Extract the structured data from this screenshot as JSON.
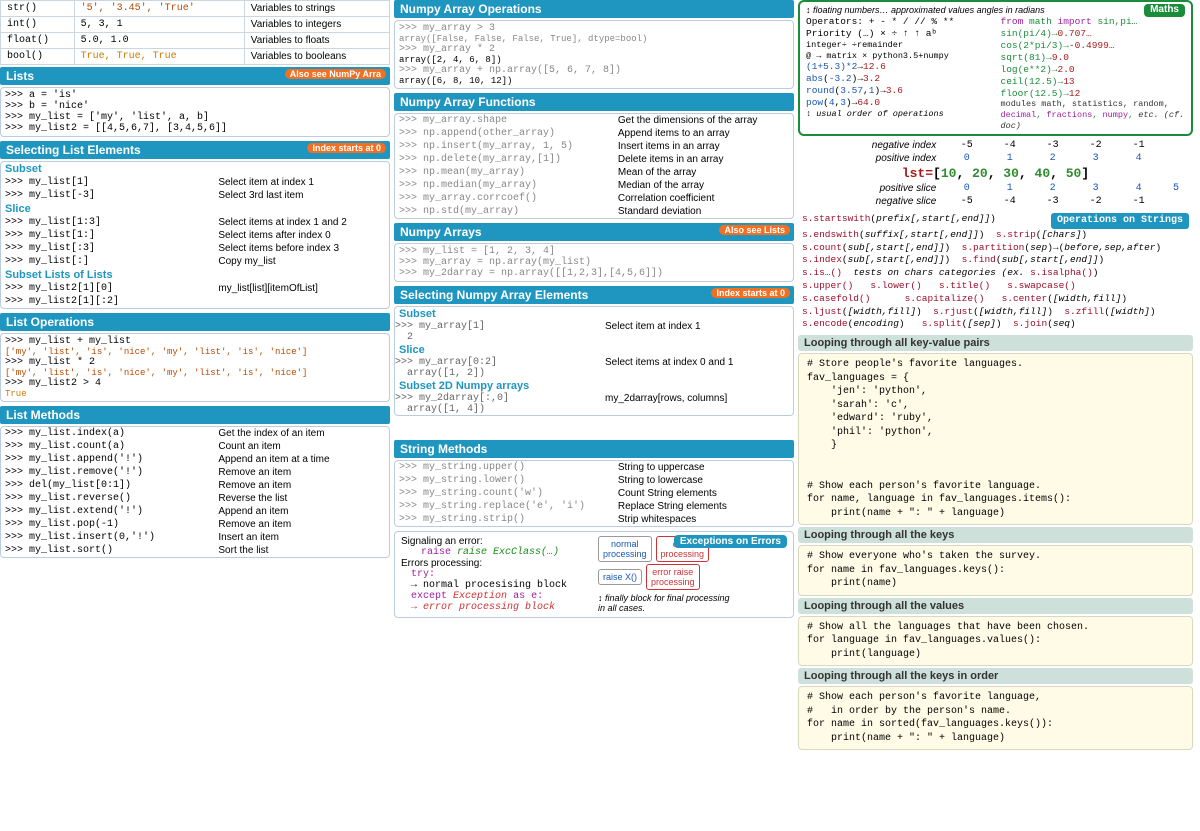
{
  "conv": {
    "rows": [
      {
        "fn": "str()",
        "ex": "'5', '3.45', 'True'",
        "desc": "Variables to strings"
      },
      {
        "fn": "int()",
        "ex": "5, 3, 1",
        "desc": "Variables to integers"
      },
      {
        "fn": "float()",
        "ex": "5.0, 1.0",
        "desc": "Variables to floats"
      },
      {
        "fn": "bool()",
        "ex": "True, True, True",
        "desc": "Variables to booleans"
      }
    ]
  },
  "lists": {
    "header": "Lists",
    "tag": "Also see NumPy Arra",
    "code": ">>> a = 'is'\n>>> b = 'nice'\n>>> my_list = ['my', 'list', a, b]\n>>> my_list2 = [[4,5,6,7], [3,4,5,6]]"
  },
  "selList": {
    "header": "Selecting List Elements",
    "tag": "Index starts at 0",
    "subset": "Subset",
    "subsetRows": [
      {
        "l": ">>> my_list[1]",
        "r": "Select item at index 1"
      },
      {
        "l": ">>> my_list[-3]",
        "r": "Select 3rd last item"
      }
    ],
    "slice": "Slice",
    "sliceRows": [
      {
        "l": ">>> my_list[1:3]",
        "r": "Select items at index 1 and 2"
      },
      {
        "l": ">>> my_list[1:]",
        "r": "Select items after index 0"
      },
      {
        "l": ">>> my_list[:3]",
        "r": "Select items before index 3"
      },
      {
        "l": ">>> my_list[:]",
        "r": "Copy my_list"
      }
    ],
    "subl": "Subset Lists of Lists",
    "sublRows": [
      {
        "l": ">>> my_list2[1][0]",
        "r": "my_list[list][itemOfList]"
      },
      {
        "l": ">>> my_list2[1][:2]",
        "r": ""
      }
    ]
  },
  "listOps": {
    "header": "List Operations",
    "lines": [
      ">>> my_list + my_list",
      "['my', 'list', 'is', 'nice', 'my', 'list', 'is', 'nice']",
      ">>> my_list * 2",
      "['my', 'list', 'is', 'nice', 'my', 'list', 'is', 'nice']",
      ">>> my_list2 > 4",
      "True"
    ]
  },
  "listMeth": {
    "header": "List Methods",
    "rows": [
      {
        "l": ">>> my_list.index(a)",
        "r": "Get the index of an item"
      },
      {
        "l": ">>> my_list.count(a)",
        "r": "Count an item"
      },
      {
        "l": ">>> my_list.append('!')",
        "r": "Append an item at a time"
      },
      {
        "l": ">>> my_list.remove('!')",
        "r": "Remove an item"
      },
      {
        "l": ">>> del(my_list[0:1])",
        "r": "Remove an item"
      },
      {
        "l": ">>> my_list.reverse()",
        "r": "Reverse the list"
      },
      {
        "l": ">>> my_list.extend('!')",
        "r": "Append an item"
      },
      {
        "l": ">>> my_list.pop(-1)",
        "r": "Remove an item"
      },
      {
        "l": ">>> my_list.insert(0,'!')",
        "r": "Insert an item"
      },
      {
        "l": ">>> my_list.sort()",
        "r": "Sort the list"
      }
    ]
  },
  "npOps": {
    "header": "Numpy Array Operations",
    "lines": [
      ">>> my_array > 3",
      "  array([False, False, False,  True], dtype=bool)",
      ">>> my_array * 2",
      "  array([2, 4, 6, 8])",
      ">>> my_array + np.array([5, 6, 7, 8])",
      "  array([6, 8, 10, 12])"
    ]
  },
  "npFns": {
    "header": "Numpy Array Functions",
    "rows": [
      {
        "l": ">>> my_array.shape",
        "r": "Get the dimensions of the array"
      },
      {
        "l": ">>> np.append(other_array)",
        "r": "Append items to an array"
      },
      {
        "l": ">>> np.insert(my_array, 1, 5)",
        "r": "Insert items in an array"
      },
      {
        "l": ">>> np.delete(my_array,[1])",
        "r": "Delete items in an array"
      },
      {
        "l": ">>> np.mean(my_array)",
        "r": "Mean of the array"
      },
      {
        "l": ">>> np.median(my_array)",
        "r": "Median of the array"
      },
      {
        "l": ">>> my_array.corrcoef()",
        "r": "Correlation coefficient"
      },
      {
        "l": ">>> np.std(my_array)",
        "r": "Standard deviation"
      }
    ]
  },
  "npArr": {
    "header": "Numpy Arrays",
    "tag": "Also see Lists",
    "lines": [
      ">>> my_list = [1, 2, 3, 4]",
      ">>> my_array = np.array(my_list)",
      ">>> my_2darray = np.array([[1,2,3],[4,5,6]])"
    ]
  },
  "selNp": {
    "header": "Selecting Numpy Array Elements",
    "tag": "Index starts at 0",
    "subset": "Subset",
    "subsetRow": {
      "l": ">>> my_array[1]\n  2",
      "r": "Select item at index 1"
    },
    "slice": "Slice",
    "sliceRow": {
      "l": ">>> my_array[0:2]\n  array([1, 2])",
      "r": "Select items at index 0 and 1"
    },
    "sub2d": "Subset 2D Numpy arrays",
    "sub2dRow": {
      "l": ">>> my_2darray[:,0]\n  array([1, 4])",
      "r": "my_2darray[rows, columns]"
    }
  },
  "strMeth": {
    "header": "String Methods",
    "rows": [
      {
        "l": ">>> my_string.upper()",
        "r": "String to uppercase"
      },
      {
        "l": ">>> my_string.lower()",
        "r": "String to lowercase"
      },
      {
        "l": ">>> my_string.count('w')",
        "r": "Count String elements"
      },
      {
        "l": ">>> my_string.replace('e', 'i')",
        "r": "Replace String elements"
      },
      {
        "l": ">>> my_string.strip()",
        "r": "Strip whitespaces"
      }
    ]
  },
  "exc": {
    "header": "Exceptions on Errors",
    "sig": "Signaling an error:",
    "raise": "raise ExcClass(…)",
    "proc": "Errors processing:",
    "try": "try:",
    "normal": "→ normal procesising block",
    "except": "except Exception as e:",
    "error": "→ error processing block",
    "dnorm": "normal\nprocessing",
    "draise": "raise X()",
    "derrproc": "error\nprocessing",
    "derr": "error raise\nprocessing",
    "fin": "↕ finally block for final processing\nin all cases."
  },
  "maths": {
    "header": "Maths",
    "ln1": "↕ floating numbers… approximated values        angles in radians",
    "leftLines": [
      "Operators: + - * / // % **",
      "Priority (…)   × ÷  ↑  ↑ aᵇ",
      "            integer÷ ÷remainder",
      "@ → matrix × python3.5+numpy",
      "(1+5.3)*2→12.6",
      "abs(-3.2)→3.2",
      "round(3.57,1)→3.6",
      "pow(4,3)→64.0",
      "↕ usual order of operations"
    ],
    "rightLines": [
      "from math import sin,pi…",
      "sin(pi/4)→0.707…",
      "cos(2*pi/3)→-0.4999…",
      "sqrt(81)→9.0",
      "log(e**2)→2.0",
      "ceil(12.5)→13",
      "floor(12.5)→12",
      "modules math, statistics, random,",
      "decimal, fractions, numpy, etc. (cf. doc)"
    ]
  },
  "idx": {
    "negIdx": "negative index",
    "posIdx": "positive index",
    "posSlice": "positive slice",
    "negSlice": "negative slice",
    "negIdxVals": [
      "-5",
      "-4",
      "-3",
      "-2",
      "-1"
    ],
    "posIdxVals": [
      "0",
      "1",
      "2",
      "3",
      "4"
    ],
    "lst": "lst=[10, 20, 30, 40, 50]",
    "posSliceVals": [
      "0",
      "1",
      "2",
      "3",
      "4",
      "5"
    ],
    "negSliceVals": [
      "-5",
      "-4",
      "-3",
      "-2",
      "-1"
    ]
  },
  "strops": {
    "header": "Operations on Strings",
    "lines": [
      "s.startswith(prefix[,start[,end]])",
      "s.endswith(suffix[,start[,end]])  s.strip([chars])",
      "s.count(sub[,start[,end]])  s.partition(sep)→(before,sep,after)",
      "s.index(sub[,start[,end]])  s.find(sub[,start[,end]])",
      "s.is…()  tests on chars categories (ex. s.isalpha())",
      "s.upper()   s.lower()    s.title()    s.swapcase()",
      "s.casefold()      s.capitalize()   s.center([width,fill])",
      "s.ljust([width,fill])  s.rjust([width,fill])  s.zfill([width])",
      "s.encode(encoding)   s.split([sep])  s.join(seq)"
    ]
  },
  "loops": {
    "h1": "Looping through all key-value pairs",
    "c1": "# Store people's favorite languages.\nfav_languages = {\n    'jen': 'python',\n    'sarah': 'c',\n    'edward': 'ruby',\n    'phil': 'python',\n    }\n\n\n# Show each person's favorite language.\nfor name, language in fav_languages.items():\n    print(name + \": \" + language)",
    "h2": "Looping through all the keys",
    "c2": "# Show everyone who's taken the survey.\nfor name in fav_languages.keys():\n    print(name)",
    "h3": "Looping through all the values",
    "c3": "# Show all the languages that have been chosen.\nfor language in fav_languages.values():\n    print(language)",
    "h4": "Looping through all the keys in order",
    "c4": "# Show each person's favorite language,\n#   in order by the person's name.\nfor name in sorted(fav_languages.keys()):\n    print(name + \": \" + language)"
  }
}
